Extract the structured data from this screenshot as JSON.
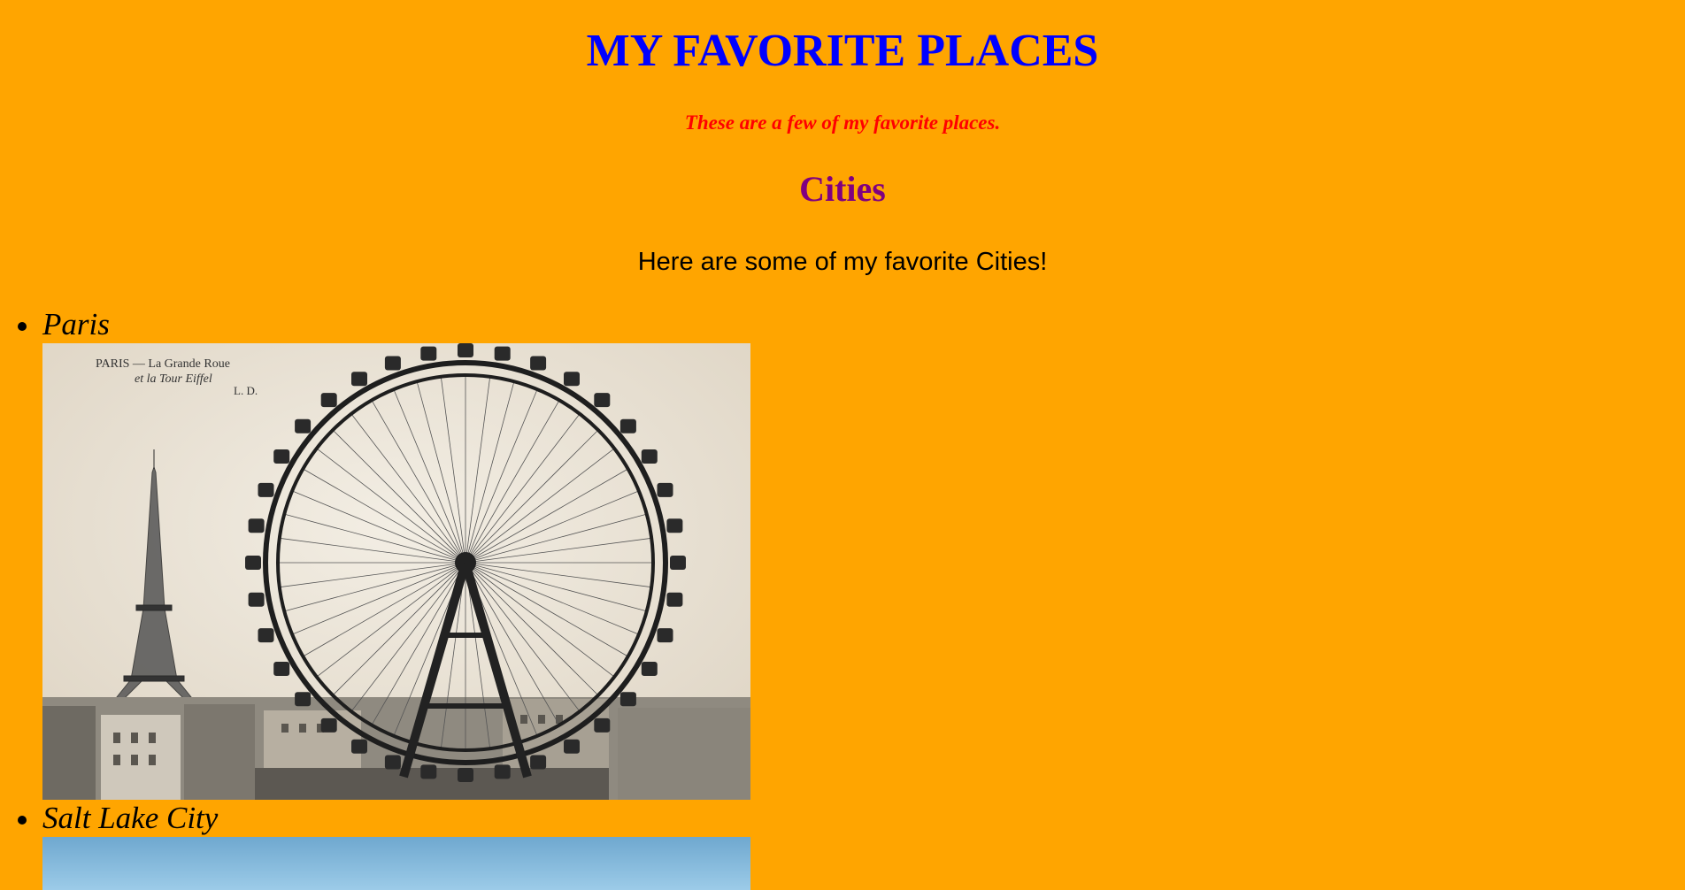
{
  "page": {
    "title": "MY FAVORITE PLACES",
    "subtitle": "These are a few of my favorite places.",
    "section_heading": "Cities",
    "section_intro": "Here are some of my favorite Cities!"
  },
  "cities": [
    {
      "name": "Paris",
      "photo_caption": {
        "line1": "PARIS — La Grande Roue",
        "line2": "et la Tour Eiffel",
        "line3": "L. D."
      }
    },
    {
      "name": "Salt Lake City"
    }
  ],
  "colors": {
    "background": "#ffa500",
    "title": "#0000ff",
    "subtitle": "#ff0000",
    "section_heading": "#800080",
    "text": "#000000"
  }
}
